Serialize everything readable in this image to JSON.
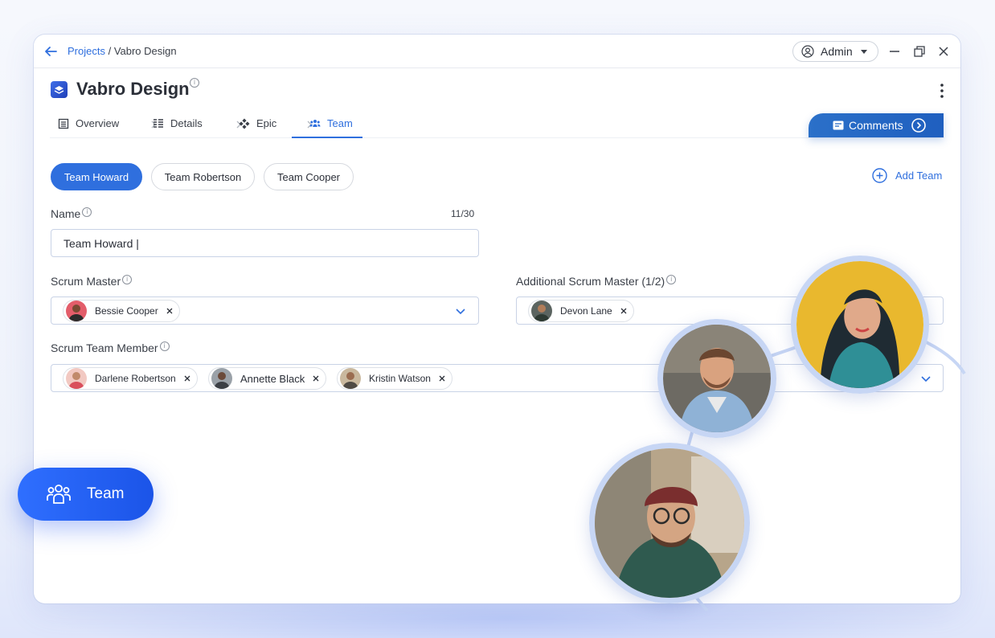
{
  "topbar": {
    "breadcrumb_link": "Projects",
    "breadcrumb_sep": " / ",
    "breadcrumb_current": "Vabro Design",
    "user_menu_label": "Admin"
  },
  "header": {
    "title": "Vabro Design"
  },
  "tabs": [
    {
      "label": "Overview",
      "icon": "overview-icon"
    },
    {
      "label": "Details",
      "icon": "details-icon"
    },
    {
      "label": "Epic",
      "icon": "epic-icon"
    },
    {
      "label": "Team",
      "icon": "team-icon",
      "active": true
    }
  ],
  "comments_label": "Comments",
  "teams": [
    "Team Howard",
    "Team Robertson",
    "Team Cooper"
  ],
  "active_team": "Team Howard",
  "add_team_label": "Add Team",
  "form": {
    "name_label": "Name",
    "name_counter": "11/30",
    "name_value": "Team Howard |",
    "scrum_master_label": "Scrum Master",
    "scrum_master": [
      "Bessie Cooper"
    ],
    "additional_label": "Additional Scrum Master (1/2)",
    "additional": [
      "Devon Lane"
    ],
    "members_label": "Scrum Team Member",
    "members": [
      "Darlene Robertson",
      "Annette Black",
      "Kristin Watson"
    ]
  },
  "floating_button_label": "Team",
  "colors": {
    "accent": "#2f6fde",
    "floating": "#1f5bf0",
    "ring": "#c7d6f4"
  }
}
